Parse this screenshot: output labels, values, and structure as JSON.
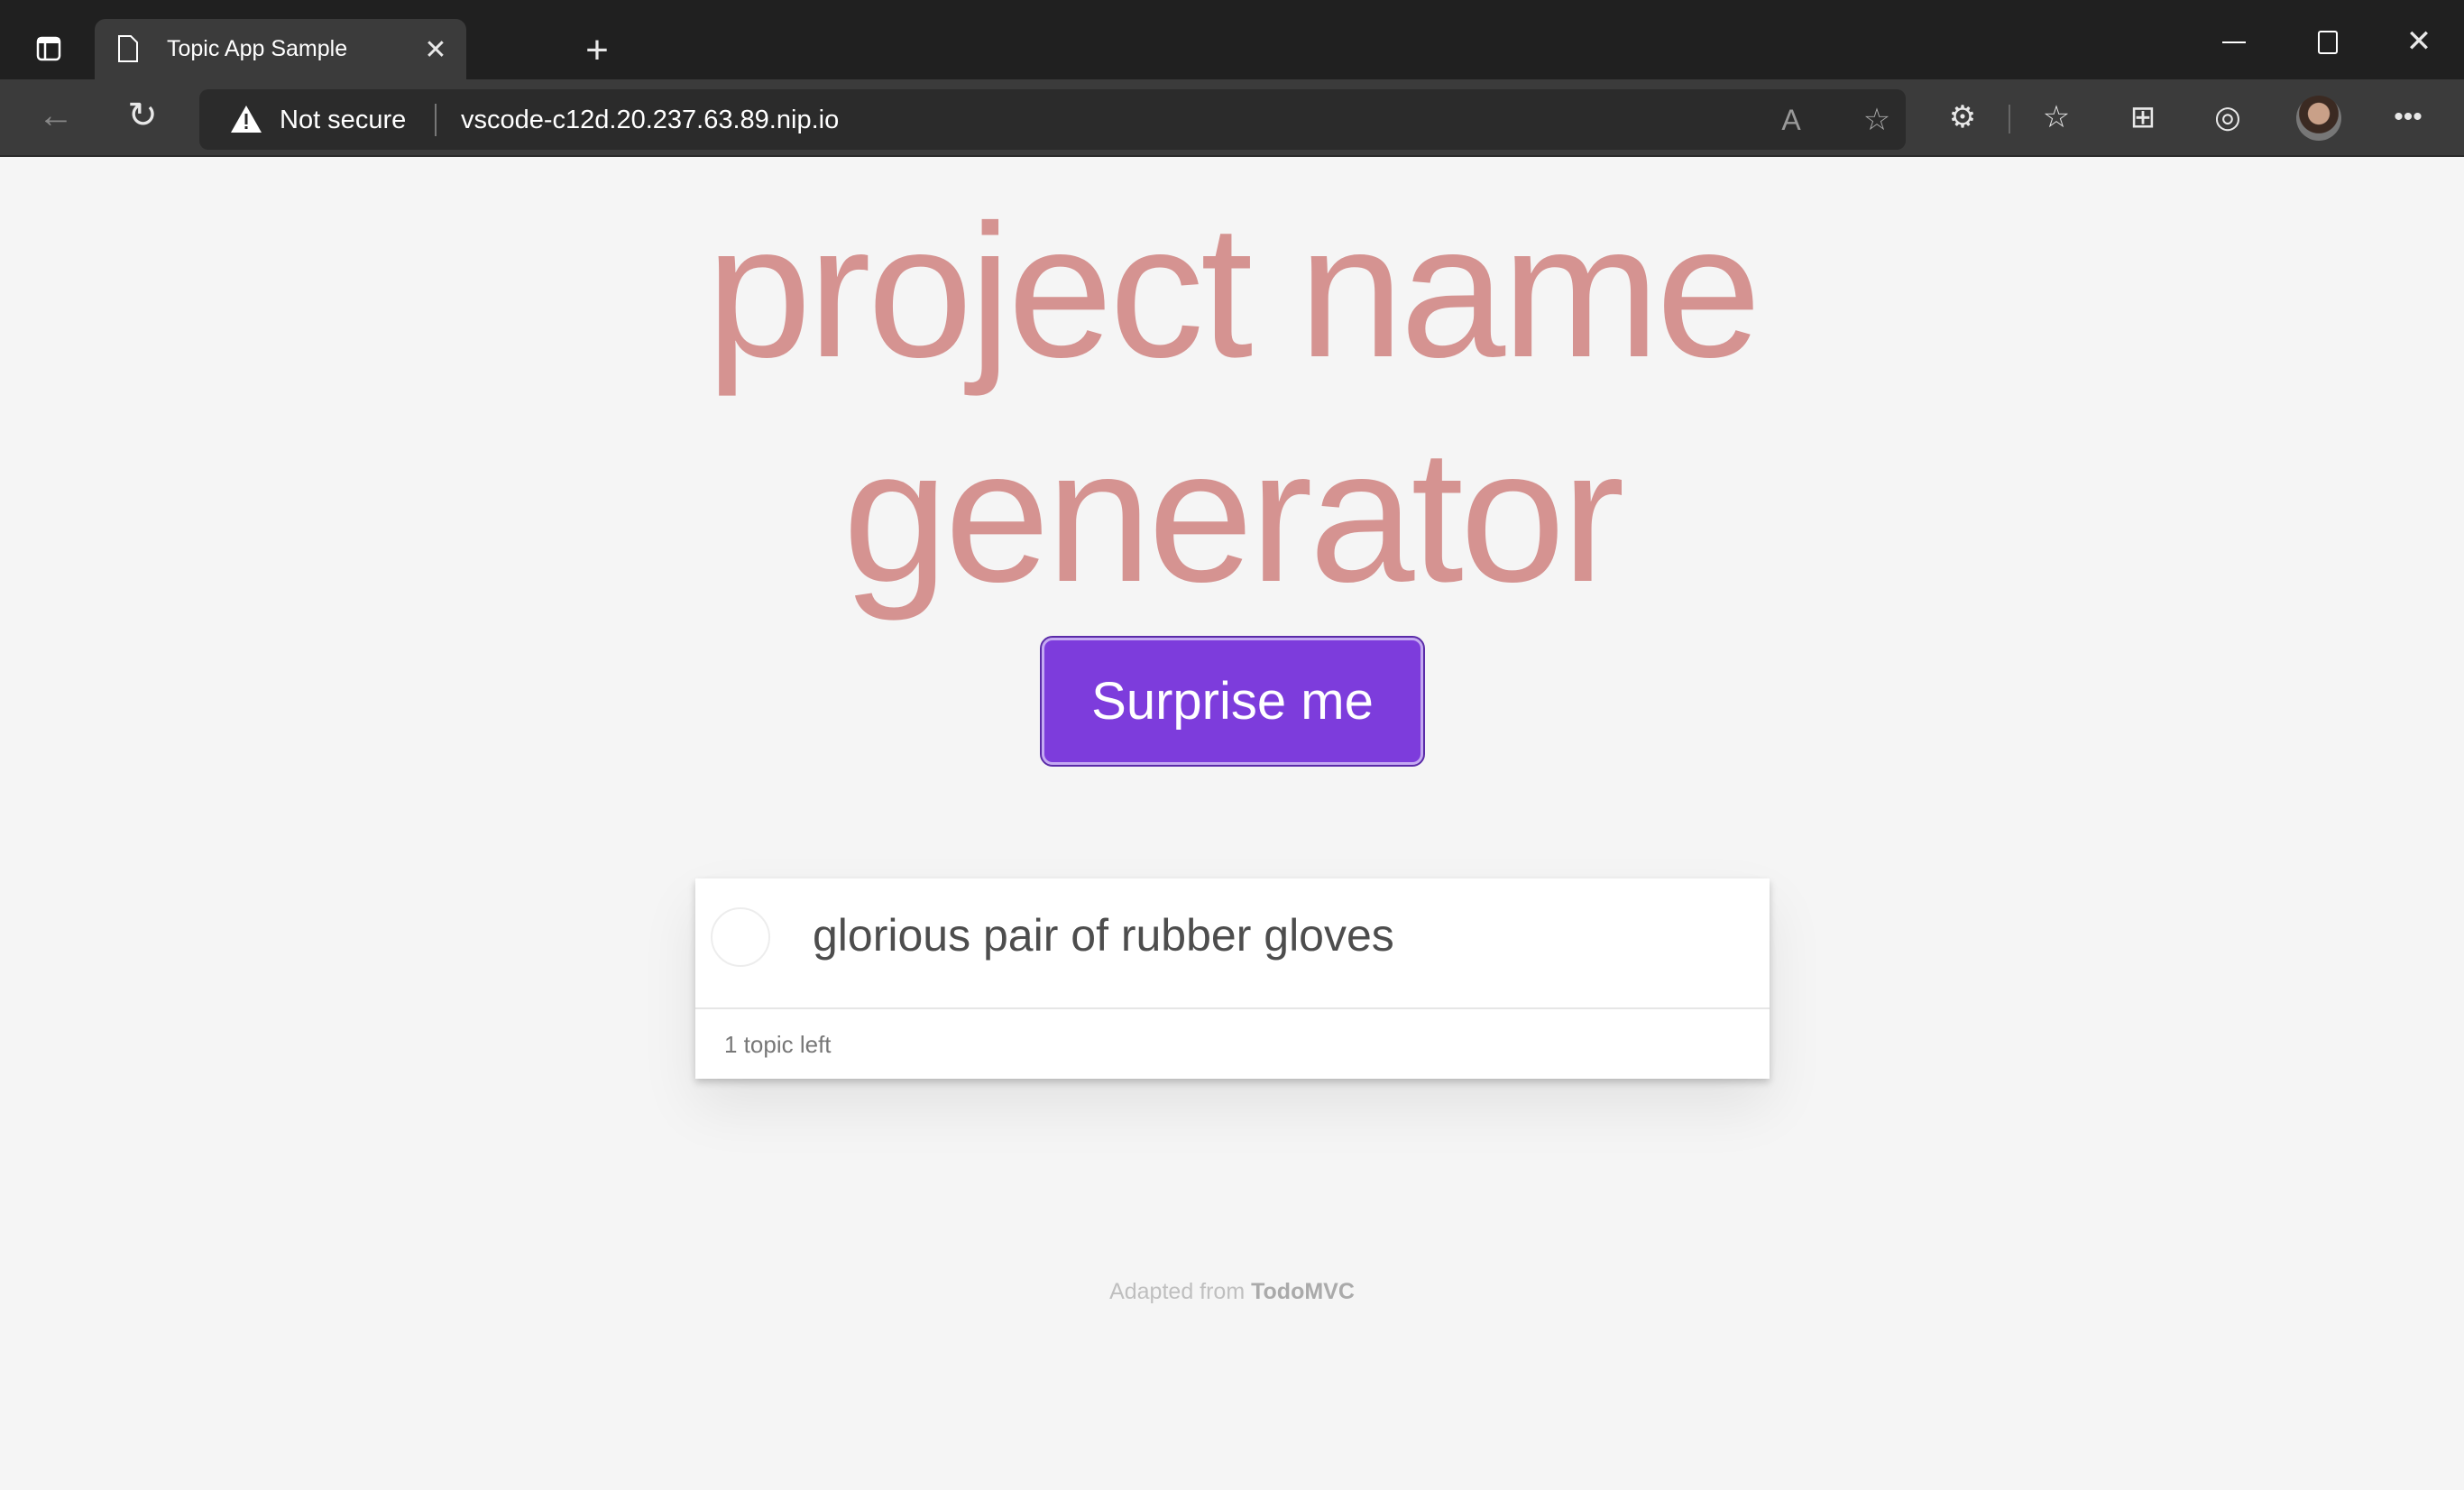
{
  "browser": {
    "tab_title": "Topic App Sample",
    "security_label": "Not secure",
    "url": "vscode-c12d.20.237.63.89.nip.io"
  },
  "app": {
    "title_line1": "project name",
    "title_line2": "generator",
    "surprise_label": "Surprise me",
    "accent_color": "#7d3cdc",
    "title_color": "#d59391",
    "topics": [
      {
        "text": "glorious pair of rubber gloves",
        "completed": false
      }
    ],
    "count_label": "1 topic left",
    "footer_prefix": "Adapted from ",
    "footer_link": "TodoMVC"
  }
}
